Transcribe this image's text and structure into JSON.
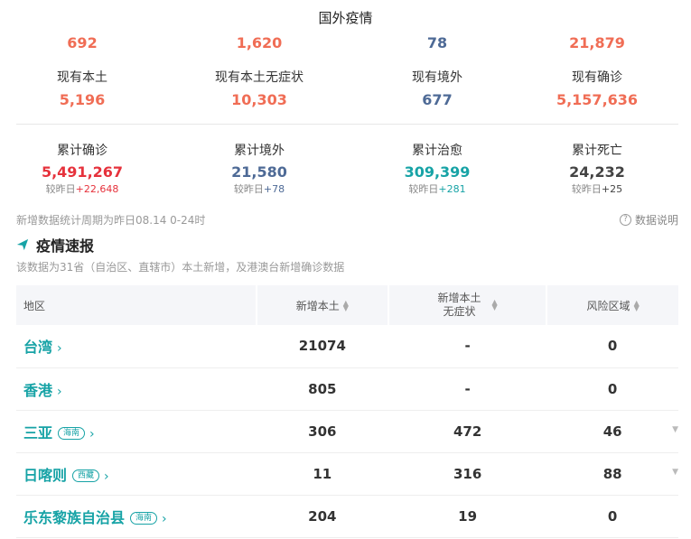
{
  "header": {
    "title": "国外疫情"
  },
  "stats_top": [
    {
      "value": "692"
    },
    {
      "value": "1,620"
    },
    {
      "value": "78"
    },
    {
      "value": "21,879"
    }
  ],
  "stats_current": [
    {
      "label": "现有本土",
      "value": "5,196"
    },
    {
      "label": "现有本土无症状",
      "value": "10,303"
    },
    {
      "label": "现有境外",
      "value": "677"
    },
    {
      "label": "现有确诊",
      "value": "5,157,636"
    }
  ],
  "stats_cumulative": [
    {
      "label": "累计确诊",
      "value": "5,491,267",
      "delta_label": "较昨日",
      "delta": "+22,648"
    },
    {
      "label": "累计境外",
      "value": "21,580",
      "delta_label": "较昨日",
      "delta": "+78"
    },
    {
      "label": "累计治愈",
      "value": "309,399",
      "delta_label": "较昨日",
      "delta": "+281"
    },
    {
      "label": "累计死亡",
      "value": "24,232",
      "delta_label": "较昨日",
      "delta": "+25"
    }
  ],
  "period_note": "新增数据统计周期为昨日08.14 0-24时",
  "data_help": "数据说明",
  "section": {
    "title": "疫情速报",
    "subtitle": "该数据为31省（自治区、直辖市）本土新增，及港澳台新增确诊数据"
  },
  "table": {
    "headers": {
      "region": "地区",
      "new_local": "新增本土",
      "new_asym_1": "新增本土",
      "new_asym_2": "无症状",
      "risk": "风险区域"
    },
    "rows": [
      {
        "region": "台湾",
        "tag": "",
        "new_local": "21074",
        "new_asym": "-",
        "risk": "0",
        "expandable": false
      },
      {
        "region": "香港",
        "tag": "",
        "new_local": "805",
        "new_asym": "-",
        "risk": "0",
        "expandable": false
      },
      {
        "region": "三亚",
        "tag": "海南",
        "new_local": "306",
        "new_asym": "472",
        "risk": "46",
        "expandable": true
      },
      {
        "region": "日喀则",
        "tag": "西藏",
        "new_local": "11",
        "new_asym": "316",
        "risk": "88",
        "expandable": true
      },
      {
        "region": "乐东黎族自治县",
        "tag": "海南",
        "new_local": "204",
        "new_asym": "19",
        "risk": "0",
        "expandable": false
      }
    ]
  },
  "colors": {
    "orange": "#f06d55",
    "blue": "#4e6a96",
    "red": "#e6323c",
    "teal": "#17a3a6"
  }
}
